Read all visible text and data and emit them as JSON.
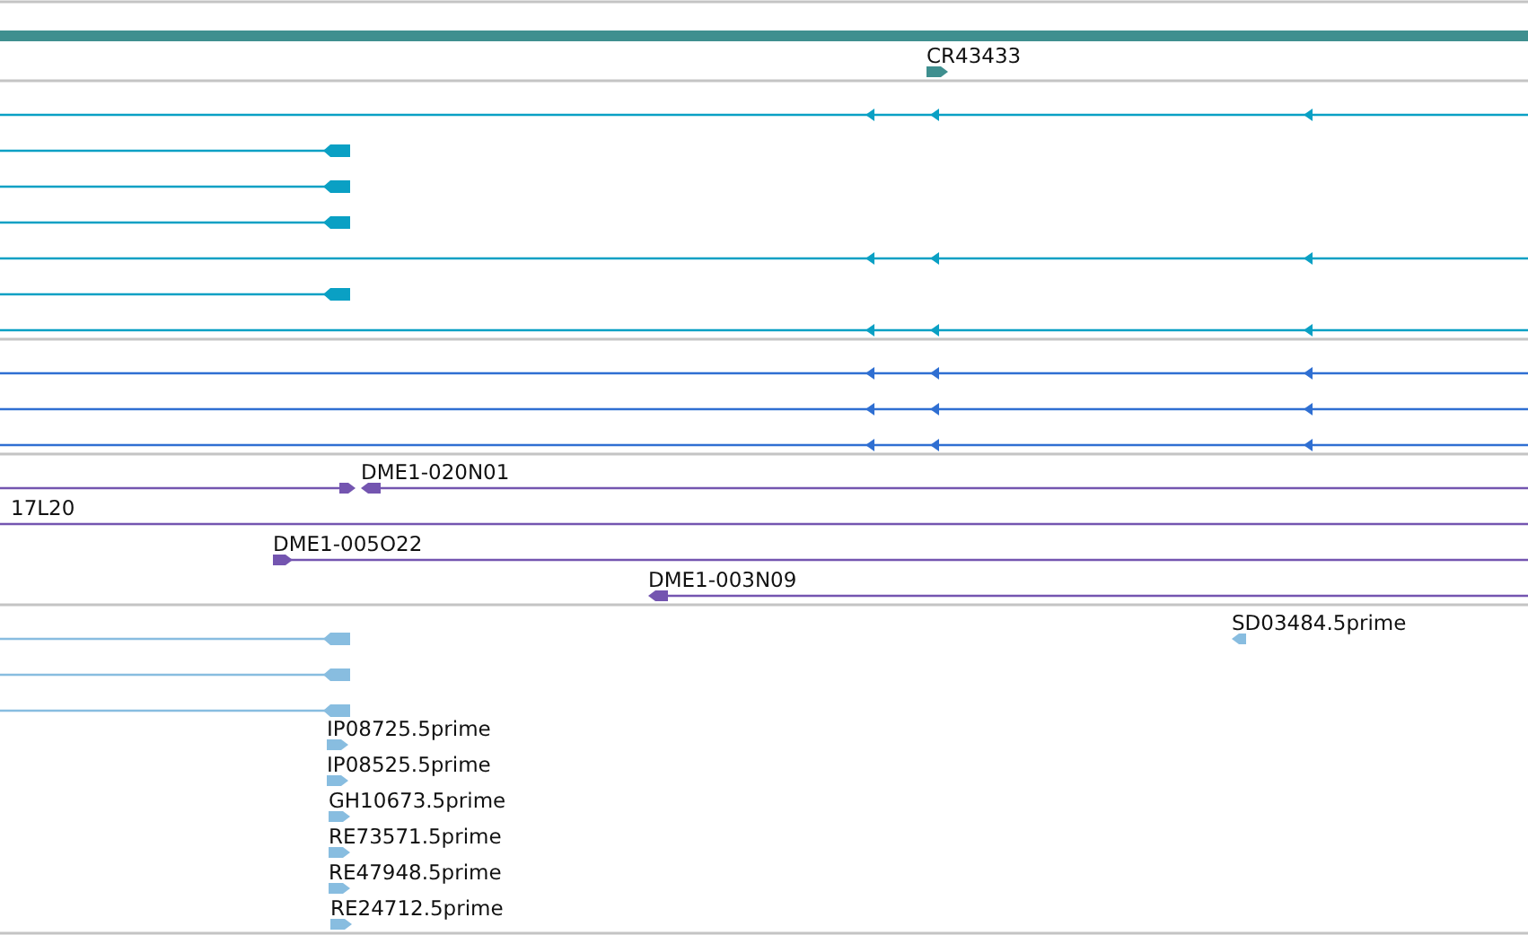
{
  "tracks": [
    {
      "color": "#3f8f8f",
      "rows": [
        [
          {
            "kind": "bar"
          }
        ],
        [
          {
            "kind": "block",
            "reverse": false,
            "label": "CR43433"
          }
        ]
      ]
    },
    {
      "color": "#0aa0c4",
      "rows": [
        [
          {
            "kind": "spliced",
            "reverse": true
          }
        ],
        [
          {
            "kind": "line_end",
            "reverse": true
          }
        ],
        [
          {
            "kind": "line_end",
            "reverse": true
          }
        ],
        [
          {
            "kind": "line_end",
            "reverse": true
          }
        ],
        [
          {
            "kind": "spliced",
            "reverse": true
          }
        ],
        [
          {
            "kind": "line_end",
            "reverse": true
          }
        ],
        [
          {
            "kind": "spliced",
            "reverse": true
          }
        ]
      ]
    },
    {
      "color": "#2f6fd2",
      "rows": [
        [
          {
            "kind": "spliced",
            "reverse": true
          }
        ],
        [
          {
            "kind": "spliced",
            "reverse": true
          }
        ],
        [
          {
            "kind": "spliced",
            "reverse": true
          }
        ]
      ]
    },
    {
      "color": "#7455b0",
      "rows": [
        [
          {
            "kind": "line_end",
            "reverse": false
          },
          {
            "kind": "line_start",
            "reverse": true,
            "label": "DME1-020N01"
          }
        ],
        [
          {
            "kind": "span",
            "label": "17L20"
          }
        ],
        [
          {
            "kind": "line_start",
            "reverse": false,
            "label": "DME1-005O22"
          }
        ],
        [
          {
            "kind": "line_start",
            "reverse": true,
            "label": "DME1-003N09"
          }
        ]
      ]
    },
    {
      "color": "#88bde0",
      "rows": [
        [
          {
            "kind": "line_end",
            "reverse": true
          },
          {
            "kind": "block",
            "reverse": true,
            "label": "SD03484.5prime"
          }
        ],
        [
          {
            "kind": "line_end",
            "reverse": true
          }
        ],
        [
          {
            "kind": "line_end",
            "reverse": true
          }
        ],
        [
          {
            "kind": "block",
            "reverse": false,
            "label": "IP08725.5prime"
          }
        ],
        [
          {
            "kind": "block",
            "reverse": false,
            "label": "IP08525.5prime"
          }
        ],
        [
          {
            "kind": "block",
            "reverse": false,
            "label": "GH10673.5prime"
          }
        ],
        [
          {
            "kind": "block",
            "reverse": false,
            "label": "RE73571.5prime"
          }
        ],
        [
          {
            "kind": "block",
            "reverse": false,
            "label": "RE47948.5prime"
          }
        ],
        [
          {
            "kind": "block",
            "reverse": false,
            "label": "RE24712.5prime"
          }
        ]
      ]
    }
  ]
}
